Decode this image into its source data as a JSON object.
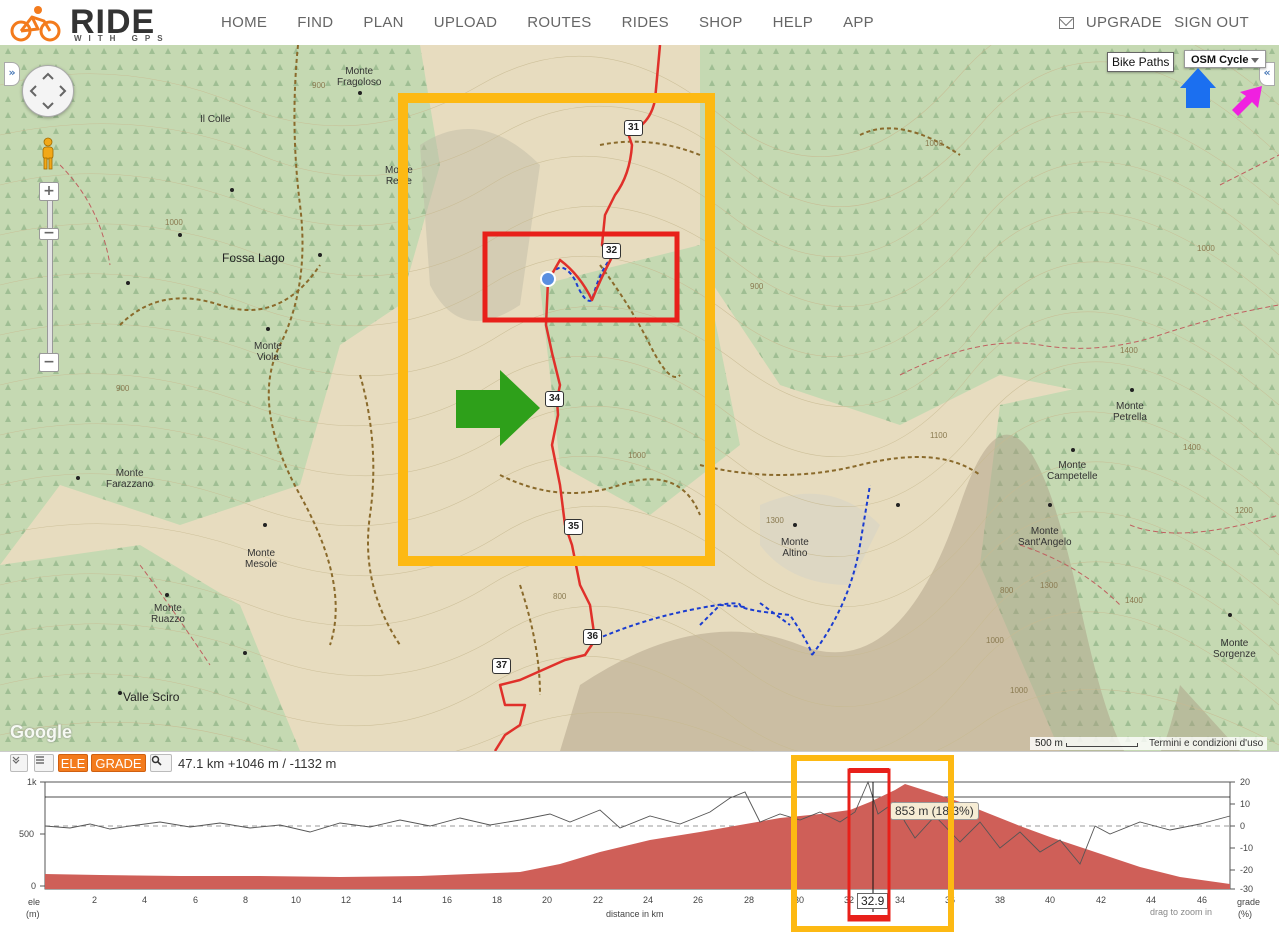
{
  "header": {
    "logo_main": "RIDE",
    "logo_sub": "WITH GPS",
    "nav": [
      "HOME",
      "FIND",
      "PLAN",
      "UPLOAD",
      "ROUTES",
      "RIDES",
      "SHOP",
      "HELP",
      "APP"
    ],
    "upgrade": "UPGRADE",
    "signout": "SIGN OUT"
  },
  "map": {
    "bike_paths": "Bike Paths",
    "layer": "OSM Cycle",
    "google": "Google",
    "scale": "500 m",
    "terms": "Termini e condizioni d'uso",
    "places": {
      "fragoloso": "Monte\nFragoloso",
      "colle": "Il Colle",
      "reale": "Monte\nReale",
      "fossa": "Fossa Lago",
      "viola": "Monte\nViola",
      "farazzano": "Monte\nFarazzano",
      "mesole": "Monte\nMesole",
      "ruazzo": "Monte\nRuazzo",
      "sciro": "Valle Sciro",
      "altino": "Monte\nAltino",
      "petrella": "Monte\nPetrella",
      "campetelle": "Monte\nCampetelle",
      "santangelo": "Monte\nSant'Angelo",
      "sorgenze": "Monte\nSorgenze"
    },
    "contours": {
      "c1": "1000",
      "c2": "1000",
      "c3": "900",
      "c4": "800",
      "c5": "900",
      "c6": "1300",
      "c7": "1400",
      "c8": "1400",
      "c9": "1000",
      "c10": "1200",
      "c11": "900",
      "c12": "1000",
      "c13": "1100",
      "c14": "1300",
      "c15": "800",
      "c16": "1400",
      "c17": "1000",
      "c18": "1000"
    },
    "markers": {
      "m31": "31",
      "m32": "32",
      "m34": "34",
      "m35": "35",
      "m36": "36",
      "m37": "37"
    }
  },
  "elevation": {
    "ele_button": "ELE",
    "grade_button": "GRADE",
    "stats": "47.1 km +1046 m / -1132 m",
    "tooltip": "853 m (18.3%)",
    "cursor_distance": "32.9",
    "y_left": [
      "1k",
      "500",
      "0"
    ],
    "y_right": [
      "20",
      "10",
      "0",
      "-10",
      "-20",
      "-30"
    ],
    "x_ticks": [
      "2",
      "4",
      "6",
      "8",
      "10",
      "12",
      "14",
      "16",
      "18",
      "20",
      "22",
      "24",
      "26",
      "28",
      "30",
      "32",
      "34",
      "36",
      "38",
      "40",
      "42",
      "44",
      "46"
    ],
    "ele_label": "ele",
    "ele_unit": "(m)",
    "grade_label": "grade",
    "grade_unit": "(%)",
    "x_label": "distance in km",
    "hint": "drag to zoom in"
  }
}
